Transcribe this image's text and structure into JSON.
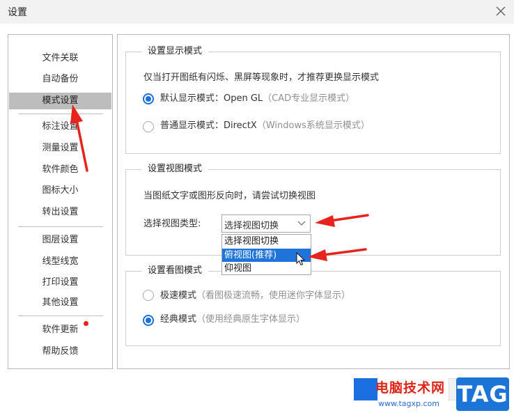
{
  "window": {
    "title": "设置"
  },
  "sidebar": {
    "items": [
      {
        "label": "文件关联"
      },
      {
        "label": "自动备份"
      },
      {
        "label": "模式设置"
      },
      {
        "label": "标注设置"
      },
      {
        "label": "测量设置"
      },
      {
        "label": "软件颜色"
      },
      {
        "label": "图标大小"
      },
      {
        "label": "转出设置"
      },
      {
        "label": "图层设置"
      },
      {
        "label": "线型线宽"
      },
      {
        "label": "打印设置"
      },
      {
        "label": "其他设置"
      },
      {
        "label": "软件更新"
      },
      {
        "label": "帮助反馈"
      }
    ],
    "active_index": 2
  },
  "display_mode": {
    "legend": "设置显示模式",
    "description": "仅当打开图纸有闪烁、黑屏等现象时，才推荐更换显示模式",
    "options": [
      {
        "label": "默认显示模式：Open GL",
        "hint": "（CAD专业显示模式）",
        "selected": true
      },
      {
        "label": "普通显示模式：DirectX",
        "hint": "（Windows系统显示模式）",
        "selected": false
      }
    ]
  },
  "view_mode": {
    "legend": "设置视图模式",
    "description": "当图纸文字或图形反向时，请尝试切换视图",
    "type_label": "选择视图类型:",
    "select_value": "选择视图切换",
    "options": [
      {
        "label": "选择视图切换"
      },
      {
        "label": "俯视图(推荐)"
      },
      {
        "label": "仰视图"
      }
    ],
    "highlighted_index": 1
  },
  "viewing_mode": {
    "legend": "设置看图模式",
    "options": [
      {
        "label": "极速模式",
        "hint": "（看图极速流畅，使用迷你字体显示）",
        "selected": false
      },
      {
        "label": "经典模式",
        "hint": "（使用经典原生字体显示）",
        "selected": true
      }
    ]
  },
  "watermark": {
    "brand": "电脑技术网",
    "url": "www.tagxp.com",
    "tag": "TAG"
  },
  "colors": {
    "accent": "#1a6fd8",
    "annotation_arrow": "#e8221d",
    "sidebar_active": "#bdbdbd",
    "highlight": "#1e74d8"
  },
  "icons": {
    "close": "close-icon",
    "dropdown": "chevron-down-icon",
    "cursor": "mouse-pointer-icon",
    "notification": "red-dot-badge"
  }
}
